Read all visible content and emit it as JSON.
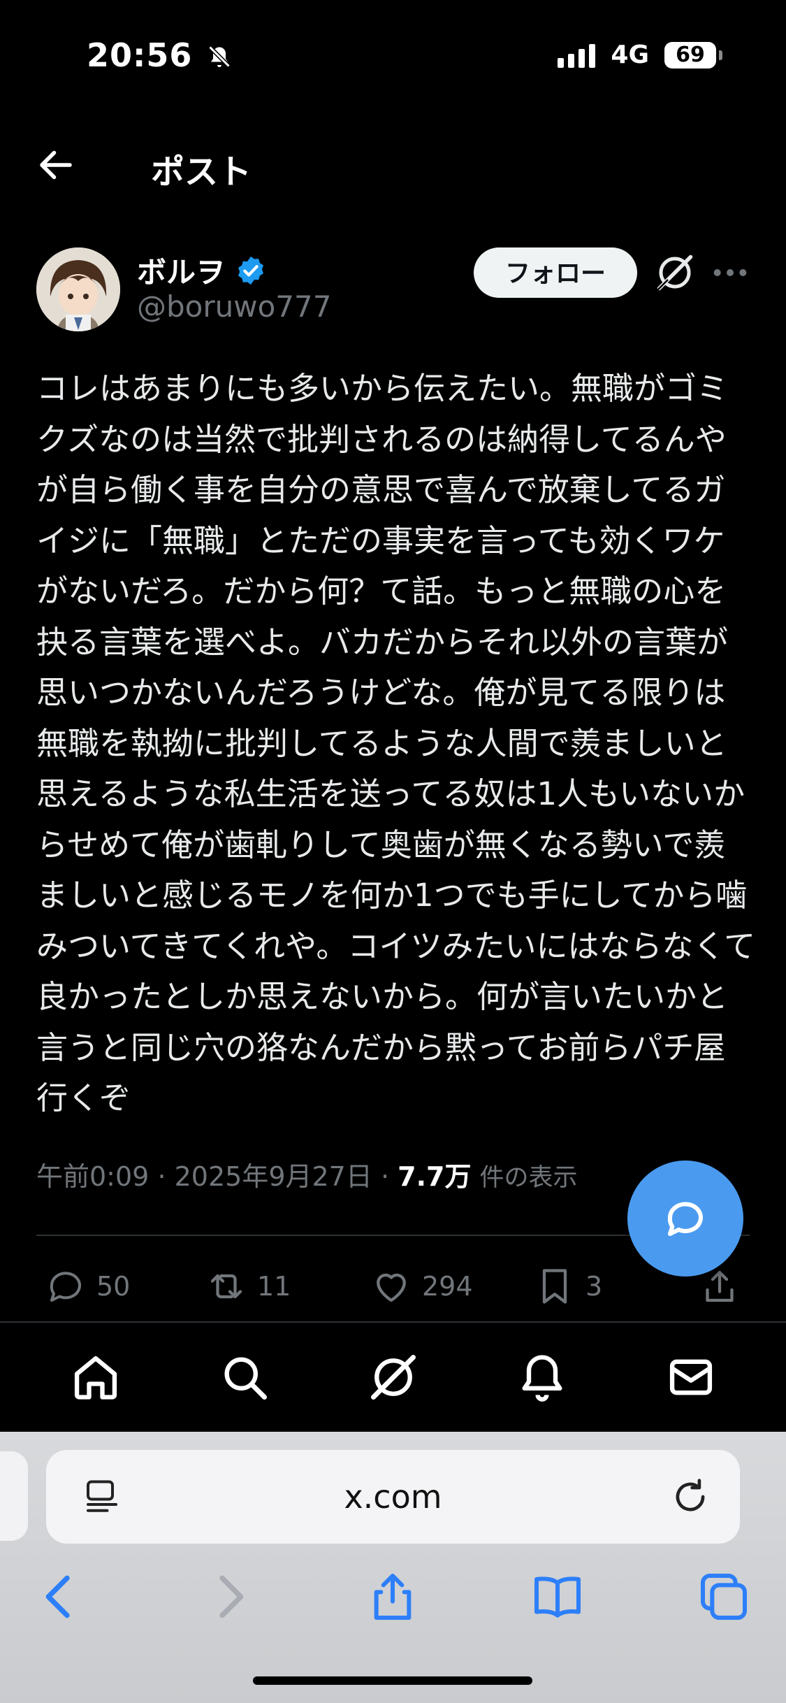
{
  "status_bar": {
    "time": "20:56",
    "network": "4G",
    "battery": "69"
  },
  "header": {
    "title": "ポスト"
  },
  "author": {
    "display_name": "ボルヲ",
    "handle": "@boruwo777"
  },
  "follow_label": "フォロー",
  "tweet": {
    "text": "コレはあまりにも多いから伝えたい。無職がゴミクズなのは当然で批判されるのは納得してるんやが自ら働く事を自分の意思で喜んで放棄してるガイジに「無職」とただの事実を言っても効くワケがないだろ。だから何？て話。もっと無職の心を抉る言葉を選べよ。バカだからそれ以外の言葉が思いつかないんだろうけどな。俺が見てる限りは無職を執拗に批判してるような人間で羨ましいと思えるような私生活を送ってる奴は1人もいないからせめて俺が歯軋りして奥歯が無くなる勢いで羨ましいと感じるモノを何か1つでも手にしてから噛みついてきてくれや。コイツみたいにはならなくて良かったとしか思えないから。何が言いたいかと言うと同じ穴の狢なんだから黙ってお前らパチ屋行くぞ",
    "time": "午前0:09",
    "date": "2025年9月27日",
    "views": "7.7万",
    "views_label": "件の表示"
  },
  "actions": {
    "replies": "50",
    "reposts": "11",
    "likes": "294",
    "bookmarks": "3"
  },
  "browser": {
    "url": "x.com"
  },
  "colors": {
    "accent": "#1d9bf0",
    "fab": "#4a9bf0",
    "background": "#000000",
    "muted": "#71767b"
  }
}
